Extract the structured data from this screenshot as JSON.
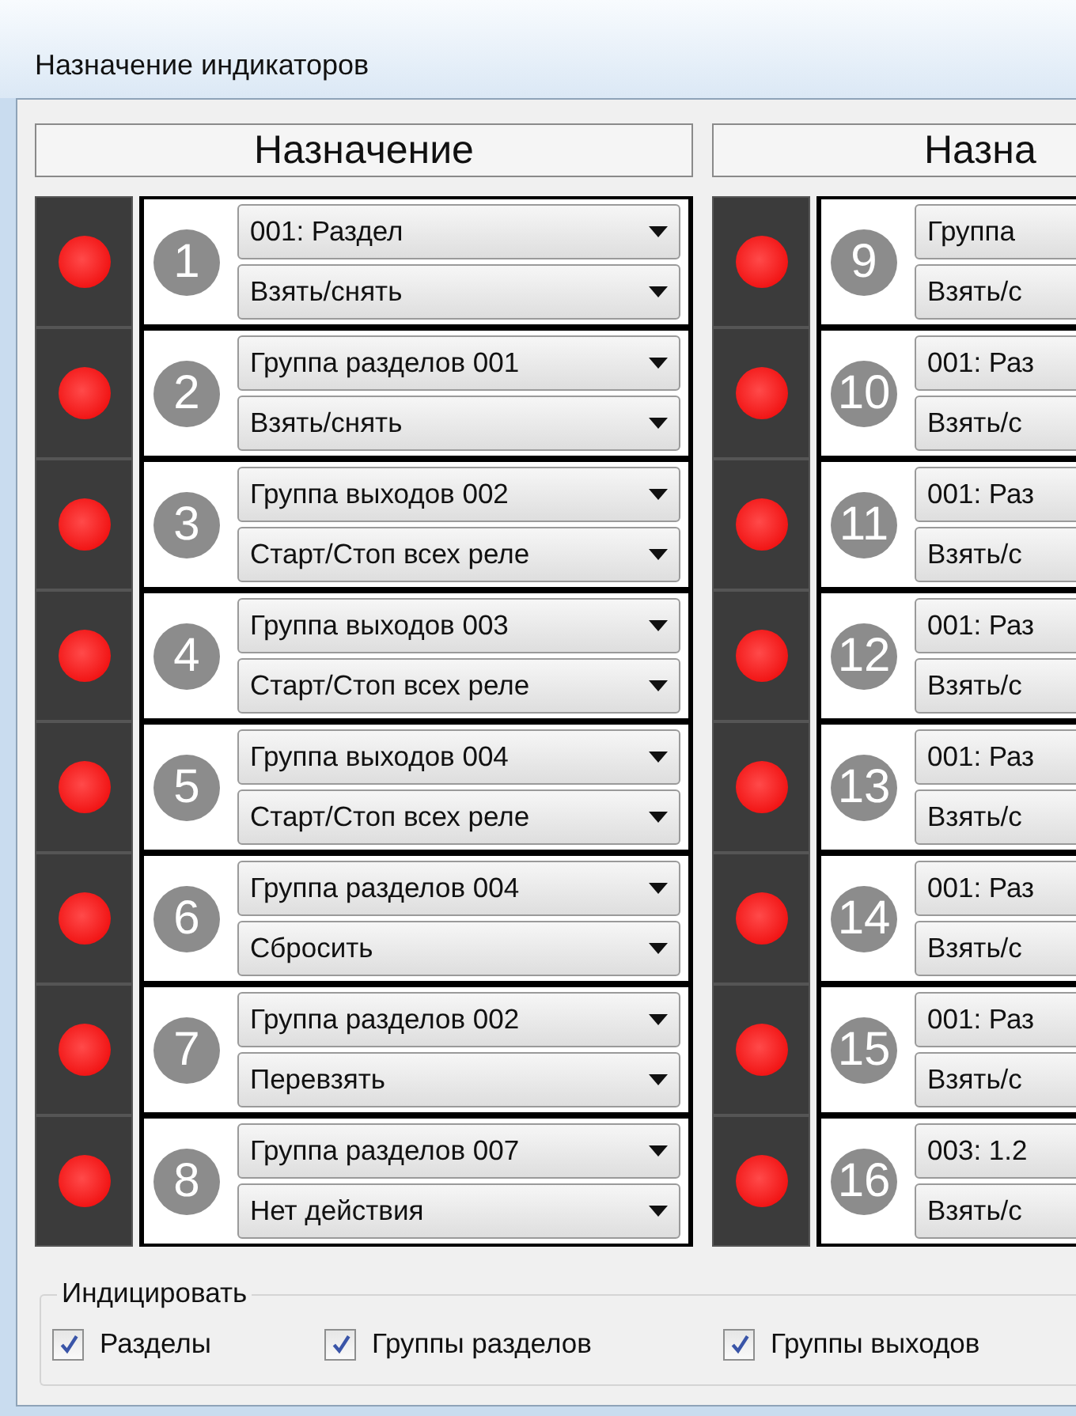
{
  "window": {
    "title": "Назначение индикаторов"
  },
  "columns": [
    {
      "header": "Назначение",
      "indicators": [
        {
          "number": "1",
          "target": "001: Раздел",
          "action": "Взять/снять"
        },
        {
          "number": "2",
          "target": "Группа разделов 001",
          "action": "Взять/снять"
        },
        {
          "number": "3",
          "target": "Группа выходов 002",
          "action": "Старт/Стоп всех реле"
        },
        {
          "number": "4",
          "target": "Группа выходов 003",
          "action": "Старт/Стоп всех реле"
        },
        {
          "number": "5",
          "target": "Группа выходов 004",
          "action": "Старт/Стоп всех реле"
        },
        {
          "number": "6",
          "target": "Группа разделов 004",
          "action": "Сбросить"
        },
        {
          "number": "7",
          "target": "Группа разделов 002",
          "action": "Перевзять"
        },
        {
          "number": "8",
          "target": "Группа разделов 007",
          "action": "Нет действия"
        }
      ]
    },
    {
      "header": "Назна",
      "indicators": [
        {
          "number": "9",
          "target": "Группа",
          "action": "Взять/с"
        },
        {
          "number": "10",
          "target": "001: Раз",
          "action": "Взять/с"
        },
        {
          "number": "11",
          "target": "001: Раз",
          "action": "Взять/с"
        },
        {
          "number": "12",
          "target": "001: Раз",
          "action": "Взять/с"
        },
        {
          "number": "13",
          "target": "001: Раз",
          "action": "Взять/с"
        },
        {
          "number": "14",
          "target": "001: Раз",
          "action": "Взять/с"
        },
        {
          "number": "15",
          "target": "001: Раз",
          "action": "Взять/с"
        },
        {
          "number": "16",
          "target": "003: 1.2",
          "action": "Взять/с"
        }
      ]
    }
  ],
  "indicate": {
    "title": "Индицировать",
    "options": [
      {
        "label": "Разделы",
        "checked": true
      },
      {
        "label": "Группы разделов",
        "checked": true
      },
      {
        "label": "Группы выходов",
        "checked": true
      }
    ]
  }
}
